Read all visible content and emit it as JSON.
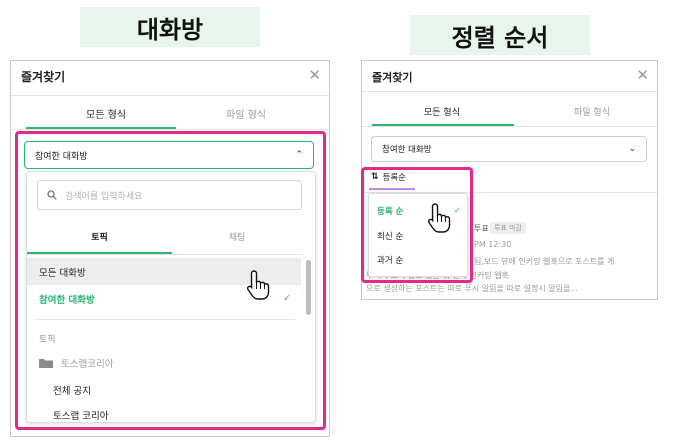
{
  "labels": {
    "left_banner": "대화방",
    "right_banner": "정렬 순서"
  },
  "left_panel": {
    "title": "즐겨찾기",
    "close": "✕",
    "tabs": [
      "모든 형식",
      "파일 형식"
    ],
    "select_value": "참여한 대화방",
    "select_chevron": "⌃",
    "dropdown": {
      "search_placeholder": "검색어를 입력하세요",
      "tabs": [
        "토픽",
        "채팅"
      ],
      "items": [
        "모든 대화방",
        "참여한 대화방"
      ],
      "selected_check": "✓",
      "section_label": "토픽",
      "folder_label": "토스랩코리아",
      "sub_items": [
        "전체 공지",
        "토스랩 코리아"
      ]
    }
  },
  "right_panel": {
    "title": "즐겨찾기",
    "close": "✕",
    "tabs": [
      "모든 형식",
      "파일 형식"
    ],
    "select_value": "참여한 대화방",
    "select_chevron": "⌄",
    "sort_icon": "⇅",
    "sort_label": "등록순",
    "sort_options": [
      "등록 순",
      "최신 순",
      "과거 순"
    ],
    "selected_check": "✓",
    "background_text": {
      "line1": "투표",
      "badge": "투표 마감",
      "line2": "PM 12:30",
      "line3": "팀,보드 뷰에 인커밍 웹훅으로 포스트를 게",
      "line4": "무시가 오지 않고 있는데, 원래 인커밍 웹훅",
      "line5": "으로 생성하는 포스트는 따로 푸시 알림을 따로 설정시 알림을..."
    }
  },
  "colors": {
    "accent_green": "#2bb673",
    "highlight_magenta": "#e4288c",
    "banner_bg": "#e7f5ec"
  }
}
